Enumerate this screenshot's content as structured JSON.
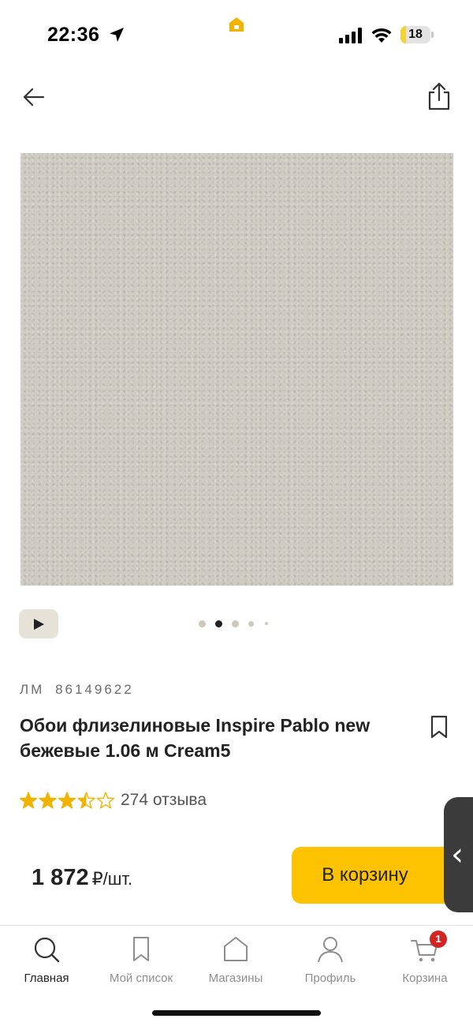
{
  "status_bar": {
    "time": "22:36",
    "battery_level": "18",
    "icons": [
      "location-arrow-icon",
      "app-home-icon",
      "signal-icon",
      "wifi-icon",
      "battery-icon"
    ]
  },
  "nav": {
    "icons": [
      "back-arrow-icon",
      "share-icon"
    ]
  },
  "product": {
    "image_colors": {
      "base": "#cdcbc2"
    },
    "gallery_dots": {
      "count": 5,
      "active_index": 1
    },
    "video_icon": "play-icon",
    "sku_prefix": "ЛМ",
    "sku": "86149622",
    "title": "Обои флизелиновые Inspire Pablo new бежевые 1.06 м Cream5",
    "rating": 3.5,
    "rating_max": 5,
    "reviews": "274 отзыва",
    "price": "1 872",
    "price_unit": "₽/шт."
  },
  "actions": {
    "cart_button": "В корзину",
    "side_handle": "‹"
  },
  "tabbar": {
    "items": [
      {
        "label": "Главная",
        "icon": "search-icon",
        "active": true
      },
      {
        "label": "Мой список",
        "icon": "bookmark-icon",
        "active": false
      },
      {
        "label": "Магазины",
        "icon": "store-icon",
        "active": false
      },
      {
        "label": "Профиль",
        "icon": "profile-icon",
        "active": false
      },
      {
        "label": "Корзина",
        "icon": "cart-icon",
        "active": false,
        "badge": "1"
      }
    ]
  },
  "colors": {
    "accent": "#fdc300",
    "badge": "#d32424",
    "star": "#f0b400",
    "text": "#222222",
    "muted": "#8e8e8e"
  }
}
